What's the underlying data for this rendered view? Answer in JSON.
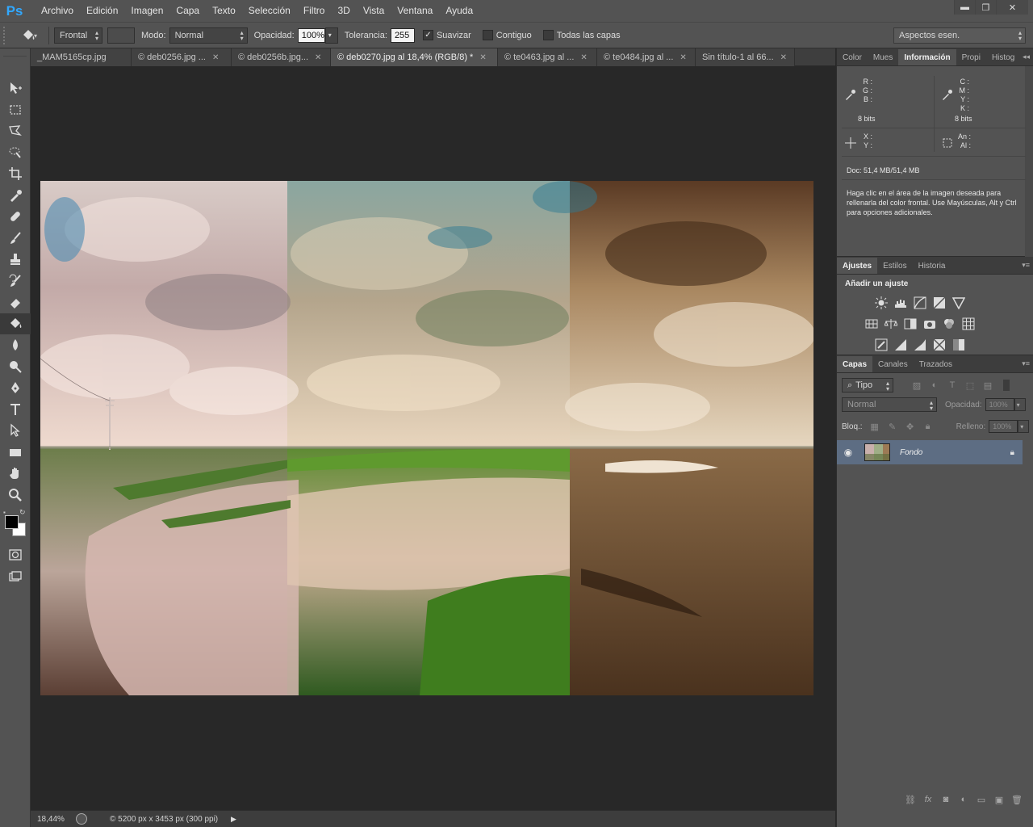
{
  "app": {
    "logo": "Ps"
  },
  "menu": [
    "Archivo",
    "Edición",
    "Imagen",
    "Capa",
    "Texto",
    "Selección",
    "Filtro",
    "3D",
    "Vista",
    "Ventana",
    "Ayuda"
  ],
  "window_controls": {
    "minimize": "▬",
    "restore": "❐",
    "close": "✕"
  },
  "options": {
    "fill_source": "Frontal",
    "mode_label": "Modo:",
    "mode_value": "Normal",
    "opacity_label": "Opacidad:",
    "opacity_value": "100%",
    "tolerance_label": "Tolerancia:",
    "tolerance_value": "255",
    "smooth_label": "Suavizar",
    "smooth_checked": true,
    "contiguous_label": "Contiguo",
    "contiguous_checked": false,
    "all_layers_label": "Todas las capas",
    "all_layers_checked": false,
    "workspace": "Aspectos esen."
  },
  "tabs": [
    {
      "label": "_MAM5165cp.jpg",
      "active": false
    },
    {
      "label": "© deb0256.jpg ...",
      "active": false
    },
    {
      "label": "© deb0256b.jpg...",
      "active": false
    },
    {
      "label": "© deb0270.jpg al 18,4% (RGB/8) *",
      "active": true
    },
    {
      "label": "© te0463.jpg al ...",
      "active": false
    },
    {
      "label": "© te0484.jpg al ...",
      "active": false
    },
    {
      "label": "Sin título-1 al 66...",
      "active": false
    }
  ],
  "status": {
    "zoom": "18,44%",
    "doc_info": "© 5200 px x 3453 px (300 ppi)"
  },
  "info_panel": {
    "tabs": [
      "Color",
      "Mues",
      "Información",
      "Propi",
      "Histog"
    ],
    "active_tab": "Información",
    "rgb_keys": [
      "R :",
      "G :",
      "B :"
    ],
    "cmyk_keys": [
      "C :",
      "M :",
      "Y :",
      "K :"
    ],
    "bits_left": "8 bits",
    "bits_right": "8 bits",
    "xy_keys": [
      "X :",
      "Y :"
    ],
    "size_keys": [
      "An :",
      "Al :"
    ],
    "doc": "Doc: 51,4 MB/51,4 MB",
    "hint": "Haga clic en el área de la imagen deseada para rellenarla del color frontal. Use Mayúsculas, Alt y Ctrl para opciones adicionales."
  },
  "adjust_panel": {
    "tabs": [
      "Ajustes",
      "Estilos",
      "Historia"
    ],
    "active_tab": "Ajustes",
    "title": "Añadir un ajuste"
  },
  "layers_panel": {
    "tabs": [
      "Capas",
      "Canales",
      "Trazados"
    ],
    "active_tab": "Capas",
    "filter_kind": "Tipo",
    "blend_mode": "Normal",
    "opacity_label": "Opacidad:",
    "opacity_value": "100%",
    "lock_label": "Bloq.:",
    "fill_label": "Relleno:",
    "fill_value": "100%",
    "layers": [
      {
        "name": "Fondo",
        "visible": true,
        "locked": true
      }
    ]
  },
  "colors": {
    "accent_logo": "#31a8ff",
    "layer_selected": "#5d6d83",
    "foreground": "#000000",
    "background": "#ffffff"
  }
}
